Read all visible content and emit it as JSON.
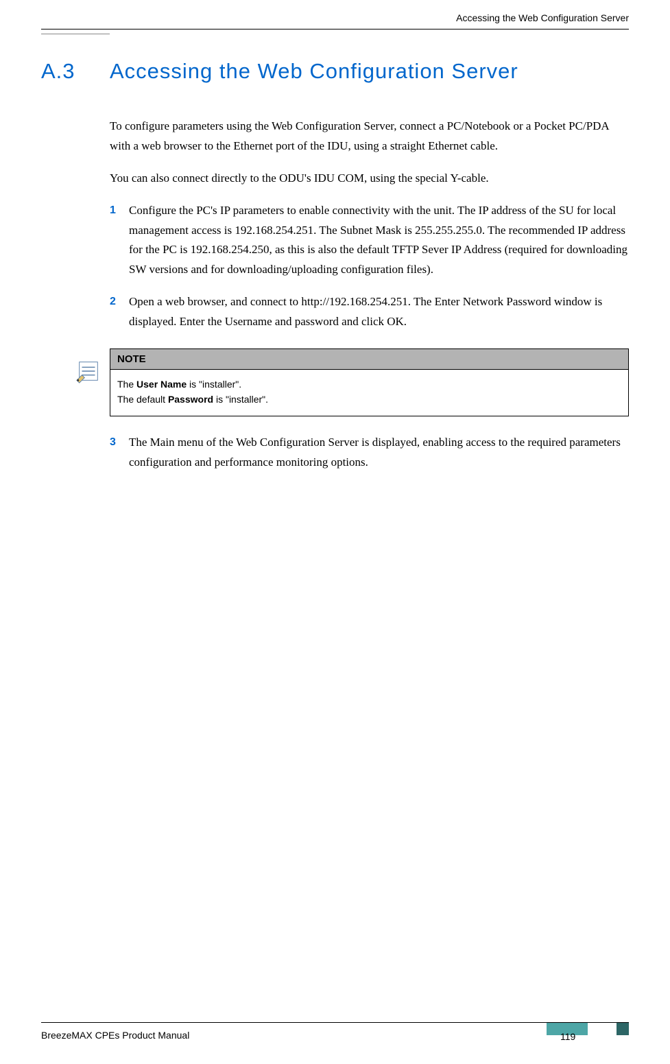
{
  "header": {
    "running_head": "Accessing the Web Configuration Server"
  },
  "section": {
    "number": "A.3",
    "title": "Accessing the Web Configuration Server"
  },
  "paragraphs": {
    "p1": "To configure parameters using the Web Configuration Server, connect a PC/Notebook or a Pocket PC/PDA with a web browser to the Ethernet port of the IDU, using a straight Ethernet cable.",
    "p2": "You can also connect directly to the ODU's IDU COM, using the special Y-cable."
  },
  "list": [
    {
      "num": "1",
      "text": "Configure the PC's IP parameters to enable connectivity with the unit. The IP address of the SU for local management access is 192.168.254.251. The Subnet Mask is 255.255.255.0. The recommended IP address for the PC is 192.168.254.250, as this is also the default TFTP Sever IP Address (required for downloading SW versions and for downloading/uploading configuration files)."
    },
    {
      "num": "2",
      "text": "Open a web browser, and connect to http://192.168.254.251. The Enter Network Password window is displayed. Enter the Username and password and click OK."
    },
    {
      "num": "3",
      "text": "The Main menu of the Web Configuration Server is displayed, enabling access to the required parameters configuration and performance monitoring options."
    }
  ],
  "note": {
    "label": "NOTE",
    "line1_pre": "The ",
    "line1_bold": "User Name",
    "line1_post": " is \"installer\".",
    "line2_pre": "The default ",
    "line2_bold": "Password",
    "line2_post": " is \"installer\"."
  },
  "footer": {
    "manual": "BreezeMAX CPEs Product Manual",
    "page": "119"
  }
}
